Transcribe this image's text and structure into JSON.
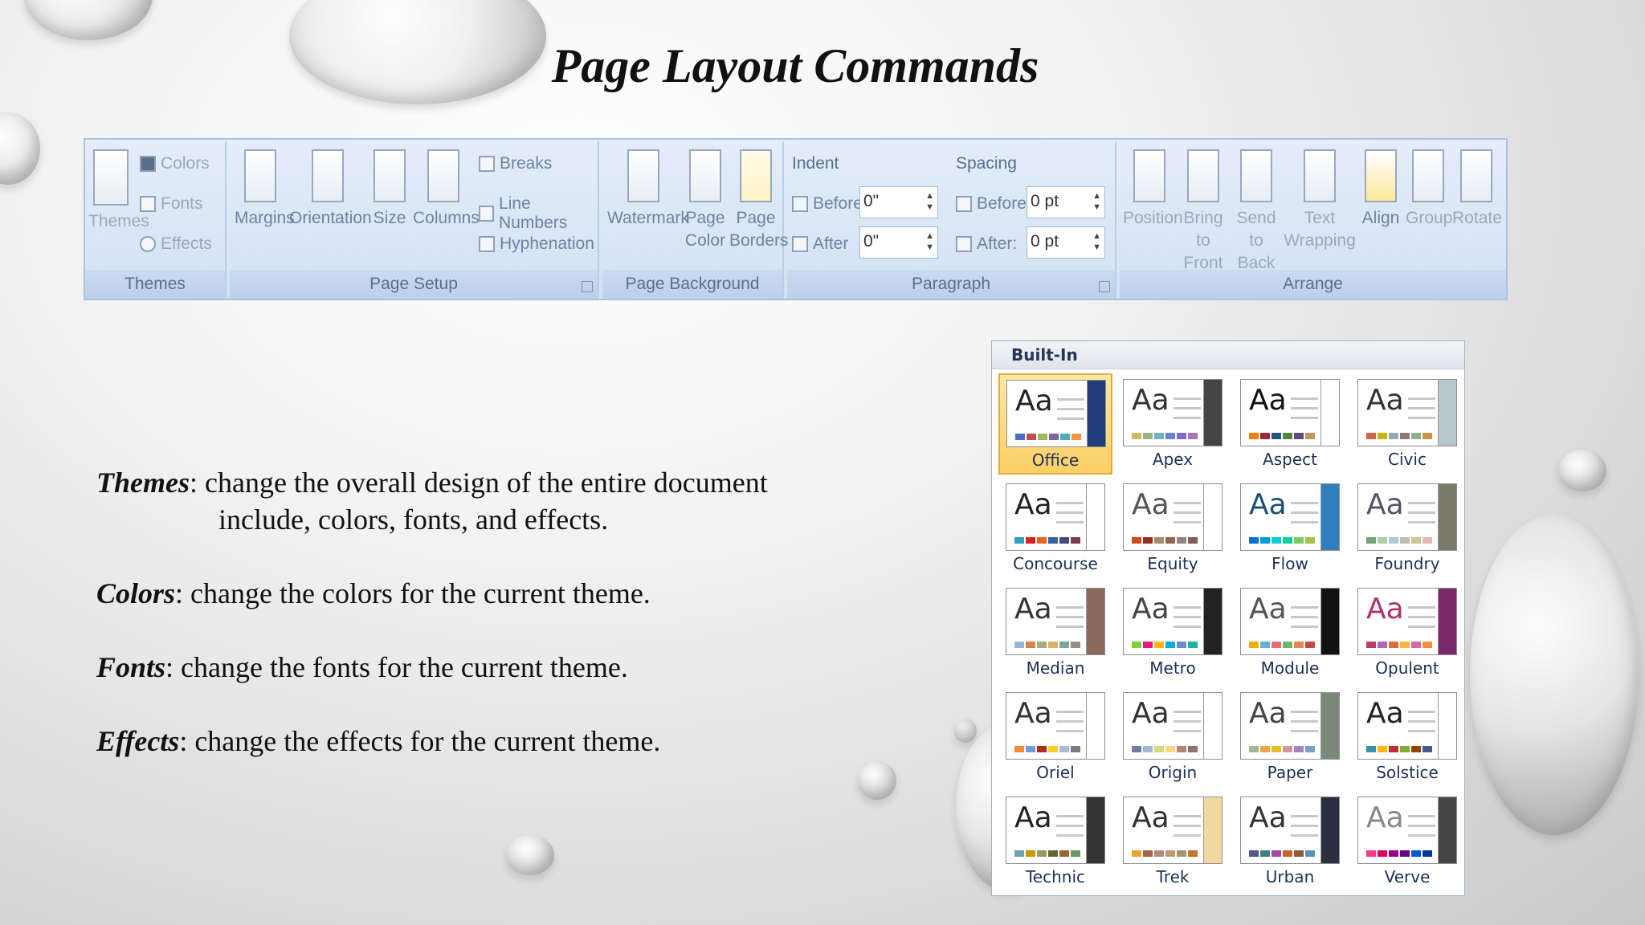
{
  "title": "Page Layout Commands",
  "ribbon": {
    "themes": {
      "group_label": "Themes",
      "themes_btn": "Themes",
      "colors": "Colors",
      "fonts": "Fonts",
      "effects": "Effects"
    },
    "page_setup": {
      "group_label": "Page Setup",
      "margins": "Margins",
      "orientation": "Orientation",
      "size": "Size",
      "columns": "Columns",
      "breaks": "Breaks",
      "line_numbers": "Line Numbers",
      "hyphenation": "Hyphenation"
    },
    "page_background": {
      "group_label": "Page Background",
      "watermark": "Watermark",
      "page_color_1": "Page",
      "page_color_2": "Color",
      "page_borders_1": "Page",
      "page_borders_2": "Borders"
    },
    "paragraph": {
      "group_label": "Paragraph",
      "indent": "Indent",
      "spacing": "Spacing",
      "before_label": "Before",
      "after_label": "After",
      "before_sp_label": "Before:",
      "after_sp_label": "After:",
      "indent_before": "0\"",
      "indent_after": "0\"",
      "spacing_before": "0 pt",
      "spacing_after": "0 pt"
    },
    "arrange": {
      "group_label": "Arrange",
      "position": "Position",
      "bring_front_1": "Bring to",
      "bring_front_2": "Front",
      "send_back_1": "Send to",
      "send_back_2": "Back",
      "text_wrap_1": "Text",
      "text_wrap_2": "Wrapping",
      "align": "Align",
      "group": "Group",
      "rotate": "Rotate"
    }
  },
  "body": {
    "themes_term": "Themes",
    "themes_text_1": ": change the overall design of the entire document",
    "themes_text_2": "include, colors, fonts, and effects.",
    "colors_term": "Colors",
    "colors_text": ": change the colors for the current theme.",
    "fonts_term": "Fonts",
    "fonts_text": ": change the fonts for the current theme.",
    "effects_term": "Effects",
    "effects_text": ": change the effects for the current theme."
  },
  "gallery": {
    "header": "Built-In",
    "themes": [
      {
        "name": "Office",
        "aa": "Aa",
        "selected": true,
        "accent": "#1f3d7a",
        "aa_color": "#222",
        "swatches": [
          "#4472c4",
          "#c0504d",
          "#9bbb59",
          "#8064a2",
          "#4bacc6",
          "#f79646"
        ]
      },
      {
        "name": "Apex",
        "aa": "Aa",
        "accent": "#444",
        "aa_color": "#333",
        "swatches": [
          "#ceb966",
          "#9cb084",
          "#6bb1c9",
          "#6585cf",
          "#7e6bc9",
          "#a379bb"
        ]
      },
      {
        "name": "Aspect",
        "aa": "Aa",
        "accent": "#fff",
        "aa_color": "#111",
        "swatches": [
          "#f07f09",
          "#9f2936",
          "#1b587c",
          "#4e8542",
          "#604878",
          "#c19859"
        ]
      },
      {
        "name": "Civic",
        "aa": "Aa",
        "accent": "#b8c7cc",
        "aa_color": "#333",
        "swatches": [
          "#d16349",
          "#ccb400",
          "#8cadae",
          "#8c7b70",
          "#8fb08c",
          "#d19049"
        ]
      },
      {
        "name": "Concourse",
        "aa": "Aa",
        "accent": "#fff",
        "aa_color": "#222",
        "swatches": [
          "#2da2bf",
          "#da1f28",
          "#eb641b",
          "#39639d",
          "#474b78",
          "#7d3c4a"
        ]
      },
      {
        "name": "Equity",
        "aa": "Aa",
        "accent": "#fff",
        "aa_color": "#555",
        "swatches": [
          "#d34817",
          "#9b2d1f",
          "#a28e6a",
          "#956251",
          "#918485",
          "#855d5d"
        ]
      },
      {
        "name": "Flow",
        "aa": "Aa",
        "accent": "#2f7fbf",
        "aa_color": "#1b4f7a",
        "swatches": [
          "#0f6fc6",
          "#009dd9",
          "#0bd0d9",
          "#10cf9b",
          "#7cca62",
          "#a5c249"
        ]
      },
      {
        "name": "Foundry",
        "aa": "Aa",
        "accent": "#7a7a6a",
        "aa_color": "#556",
        "swatches": [
          "#72a376",
          "#b0ccb0",
          "#a8cdd7",
          "#c0beaf",
          "#cec597",
          "#e8b7b7"
        ]
      },
      {
        "name": "Median",
        "aa": "Aa",
        "accent": "#8a6a5a",
        "aa_color": "#333",
        "swatches": [
          "#94b6d2",
          "#dd8047",
          "#a5ab81",
          "#d8b25c",
          "#7ba79d",
          "#968c8c"
        ]
      },
      {
        "name": "Metro",
        "aa": "Aa",
        "accent": "#222",
        "aa_color": "#444",
        "swatches": [
          "#7fd13b",
          "#ea157a",
          "#feb80a",
          "#00addc",
          "#738ac8",
          "#1ab39f"
        ]
      },
      {
        "name": "Module",
        "aa": "Aa",
        "accent": "#111",
        "aa_color": "#555",
        "swatches": [
          "#f0ad00",
          "#60b5cc",
          "#e66c7d",
          "#6bb76d",
          "#e88651",
          "#c64847"
        ]
      },
      {
        "name": "Opulent",
        "aa": "Aa",
        "accent": "#7a2a6a",
        "aa_color": "#b0306e",
        "swatches": [
          "#b83d68",
          "#ac66bb",
          "#de6c36",
          "#f9b639",
          "#cf6da4",
          "#fa8d3d"
        ]
      },
      {
        "name": "Oriel",
        "aa": "Aa",
        "accent": "#fff",
        "aa_color": "#333",
        "swatches": [
          "#fe8637",
          "#7598d9",
          "#b32c16",
          "#f5cd2d",
          "#aebad5",
          "#777c84"
        ]
      },
      {
        "name": "Origin",
        "aa": "Aa",
        "accent": "#fff",
        "aa_color": "#333",
        "swatches": [
          "#727ca3",
          "#9fb8cd",
          "#d2da7a",
          "#fada7a",
          "#b88472",
          "#8e736a"
        ]
      },
      {
        "name": "Paper",
        "aa": "Aa",
        "accent": "#7c8a7a",
        "aa_color": "#444",
        "swatches": [
          "#a5b592",
          "#f3a447",
          "#e7bc29",
          "#d092a7",
          "#9c85c0",
          "#809ec2"
        ]
      },
      {
        "name": "Solstice",
        "aa": "Aa",
        "accent": "#fff",
        "aa_color": "#222",
        "swatches": [
          "#3891a7",
          "#feb80a",
          "#c32d2e",
          "#84aa33",
          "#964305",
          "#475a8d"
        ]
      },
      {
        "name": "Technic",
        "aa": "Aa",
        "accent": "#333",
        "aa_color": "#222",
        "swatches": [
          "#6ea0b0",
          "#cc9900",
          "#999966",
          "#666633",
          "#996633",
          "#669966"
        ]
      },
      {
        "name": "Trek",
        "aa": "Aa",
        "accent": "#f0d8a0",
        "aa_color": "#333",
        "swatches": [
          "#f0a22e",
          "#a5644e",
          "#b58b80",
          "#c3986d",
          "#a19574",
          "#c17529"
        ]
      },
      {
        "name": "Urban",
        "aa": "Aa",
        "accent": "#2a3040",
        "aa_color": "#333",
        "swatches": [
          "#53548a",
          "#438086",
          "#a04da3",
          "#c4652d",
          "#8b5d3d",
          "#5c92b5"
        ]
      },
      {
        "name": "Verve",
        "aa": "Aa",
        "accent": "#444",
        "aa_color": "#888",
        "swatches": [
          "#ff388c",
          "#e40059",
          "#9c007f",
          "#68007f",
          "#005bd3",
          "#00349e"
        ]
      }
    ]
  }
}
